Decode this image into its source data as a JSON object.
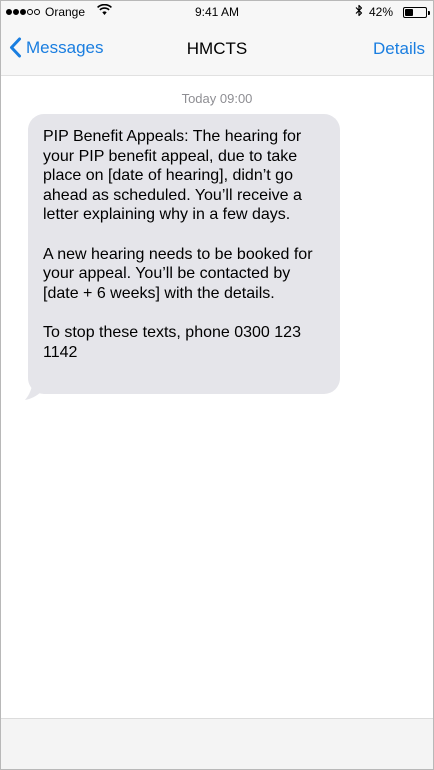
{
  "status_bar": {
    "carrier": "Orange",
    "signal_bars_filled": 3,
    "signal_bars_total": 5,
    "time": "9:41 AM",
    "battery_percent": "42%",
    "battery_level": 0.42
  },
  "nav": {
    "back_label": "Messages",
    "title": "HMCTS",
    "details_label": "Details"
  },
  "conversation": {
    "timestamp": "Today 09:00",
    "message": {
      "paragraphs": [
        "PIP Benefit Appeals: The hearing for your PIP benefit appeal, due to take place on [date of hearing], didn’t go ahead as scheduled. You’ll receive a letter explaining why in a few days.",
        "A new hearing needs to be booked for your appeal. You’ll be contacted by [date + 6 weeks] with the details.",
        "To stop these texts, phone 0300 123 1142"
      ]
    }
  },
  "colors": {
    "accent": "#1a7ee0",
    "bubble": "#e5e5ea",
    "timestamp": "#8e8e93",
    "bar_background": "#f7f7f7"
  },
  "icons": {
    "back": "chevron-left-icon",
    "wifi": "wifi-icon",
    "bluetooth": "bluetooth-icon",
    "battery": "battery-icon"
  }
}
